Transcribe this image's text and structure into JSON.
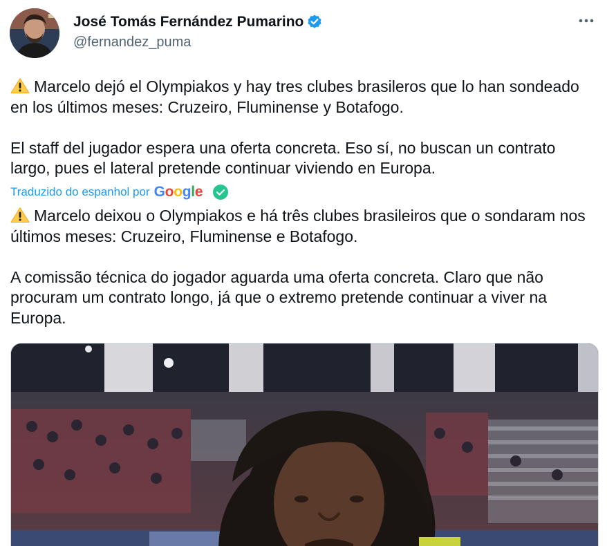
{
  "tweet": {
    "author": {
      "display_name": "José Tomás Fernández Pumarino",
      "handle": "@fernandez_puma",
      "verified": true,
      "avatar_icon": "profile-photo",
      "verified_color": "#1d9bf0"
    },
    "more_icon": "ellipsis-icon",
    "original_text": {
      "paragraph_1": "Marcelo dejó el Olympiakos y hay tres clubes brasileros que lo han sondeado en los últimos meses: Cruzeiro, Fluminense y Botafogo.",
      "paragraph_2": "El staff del jugador espera una oferta concreta. Eso sí, no buscan un contrato largo, pues el lateral pretende continuar viviendo en Europa."
    },
    "translation": {
      "label": "Traduzido do espanhol por",
      "provider_logo": "Google",
      "check_icon": "check-circle-icon",
      "paragraph_1": "Marcelo deixou o Olympiakos e há três clubes brasileiros que o sondaram nos últimos meses: Cruzeiro, Fluminense e Botafogo.",
      "paragraph_2": "A comissão técnica do jogador aguarda uma oferta concreta. Claro que não procuram um contrato longo, já que o extremo pretende continuar a viver na Europa."
    },
    "warning_icon": "warning-icon",
    "media": {
      "type": "photo",
      "description_icon": "stadium-player-photo"
    },
    "colors": {
      "text": "#0f1419",
      "secondary": "#536471",
      "link": "#1d9bf0"
    }
  }
}
